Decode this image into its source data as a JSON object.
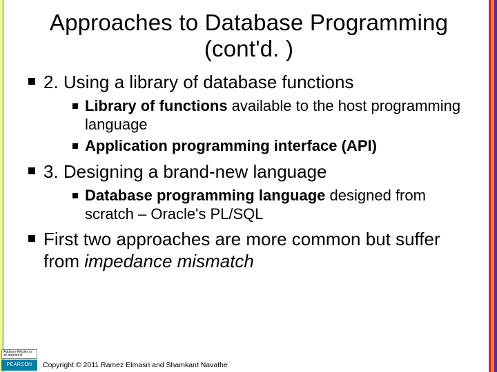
{
  "title": "Approaches to Database Programming (cont'd. )",
  "bullets": {
    "b1": "2. Using a library of database functions",
    "b1_1_strong": "Library of functions",
    "b1_1_rest": " available to the host programming language",
    "b1_2": "Application programming interface (API)",
    "b2": "3. Designing a brand-new language",
    "b2_1_strong": "Database programming language",
    "b2_1_rest": " designed from scratch – Oracle's PL/SQL",
    "b3_pre": "First two approaches are more common but suffer from ",
    "b3_em": "impedance mismatch"
  },
  "footer": {
    "logo_aw": "Addison-Wesley is an imprint of",
    "logo_pearson": "PEARSON",
    "copyright": "Copyright © 2011 Ramez Elmasri and Shamkant Navathe"
  }
}
